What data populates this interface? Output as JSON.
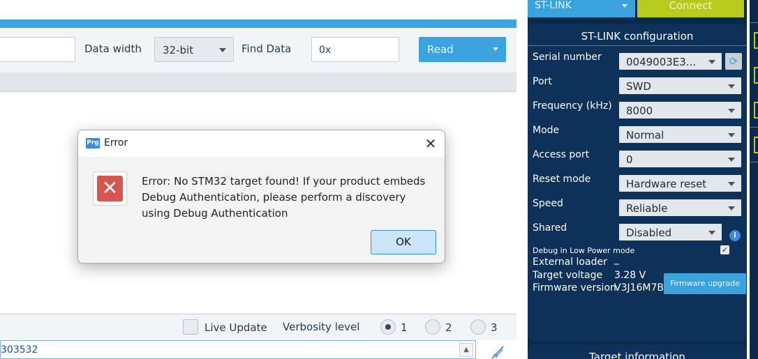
{
  "toolbar": {
    "data_width_label": "Data width",
    "data_width_value": "32-bit",
    "find_data_label": "Find Data",
    "find_data_value": "0x",
    "read_label": "Read"
  },
  "bottom_bar": {
    "live_update_label": "Live Update",
    "verbosity_label": "Verbosity level",
    "verbosity_options": [
      "1",
      "2",
      "3"
    ],
    "verbosity_selected": "1"
  },
  "log": {
    "text": "303532"
  },
  "connection": {
    "interface": "ST-LINK",
    "connect_label": "Connect"
  },
  "stlink_config": {
    "title": "ST-LINK configuration",
    "serial_number_label": "Serial number",
    "serial_number_value": "0049003E3...",
    "port_label": "Port",
    "port_value": "SWD",
    "frequency_label": "Frequency (kHz)",
    "frequency_value": "8000",
    "mode_label": "Mode",
    "mode_value": "Normal",
    "access_port_label": "Access port",
    "access_port_value": "0",
    "reset_mode_label": "Reset mode",
    "reset_mode_value": "Hardware reset",
    "speed_label": "Speed",
    "speed_value": "Reliable",
    "shared_label": "Shared",
    "shared_value": "Disabled",
    "debug_low_power_label": "Debug in Low Power mode",
    "debug_low_power_checked": true,
    "external_loader_label": "External loader",
    "external_loader_value": "_",
    "target_voltage_label": "Target voltage",
    "target_voltage_value": "3.28 V",
    "firmware_version_label": "Firmware version",
    "firmware_version_value": "V3J16M7B",
    "firmware_upgrade_label": "Firmware upgrade"
  },
  "target_info": {
    "title": "Target information"
  },
  "error_dialog": {
    "app_icon_text": "Prg",
    "title": "Error",
    "close_glyph": "✕",
    "message": "Error: No STM32 target found! If your product embeds Debug Authentication, please perform a discovery using Debug Authentication",
    "ok_label": "OK"
  },
  "colors": {
    "accent_blue": "#3aa3de",
    "connect_green": "#b6cb1e",
    "panel_navy": "#0d3158",
    "error_red": "#d9534f"
  },
  "icons": {
    "dialog_error": "error-x-icon",
    "refresh": "refresh-icon",
    "info": "info-icon",
    "log_tool": "feather-pen-icon"
  }
}
